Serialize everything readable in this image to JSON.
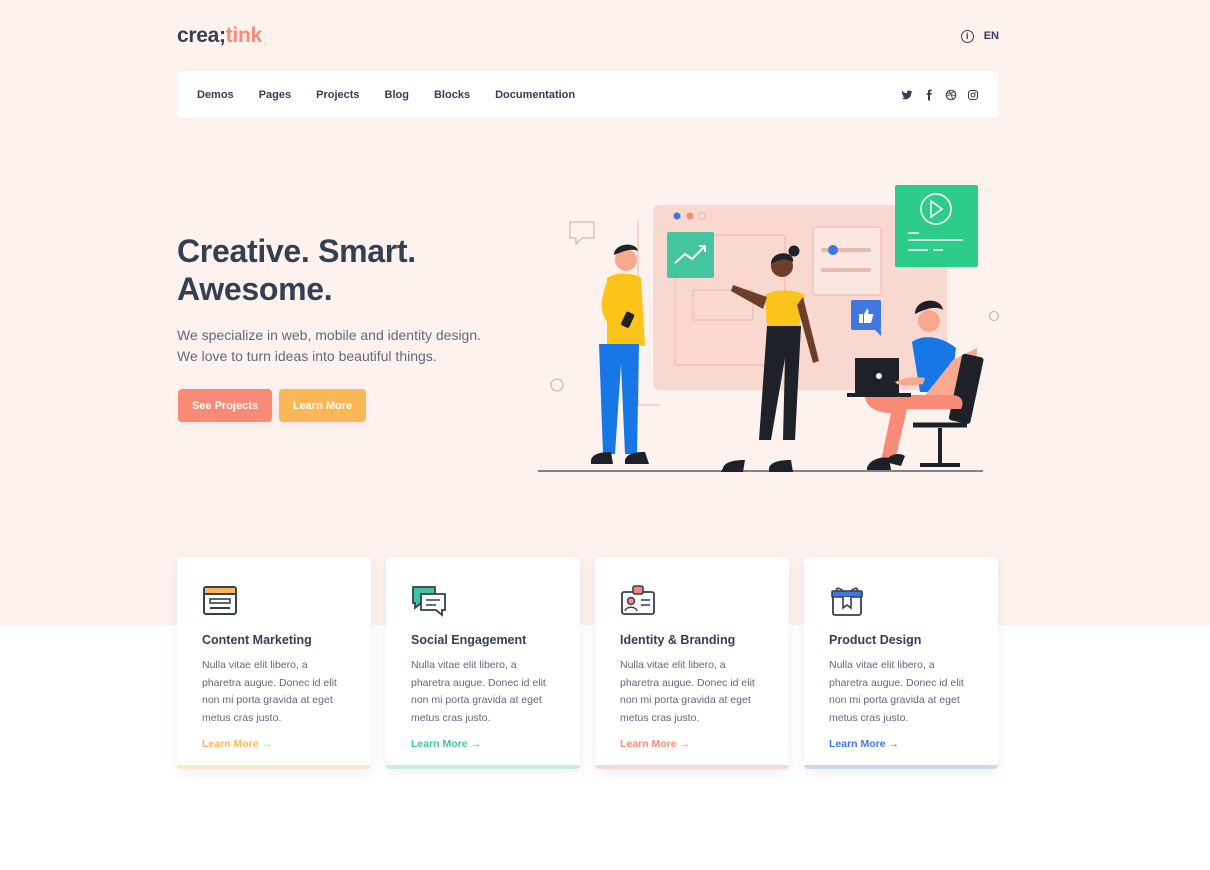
{
  "brand": {
    "logo_main": "crea;",
    "logo_accent": "tink",
    "accent_color": "#f78b77"
  },
  "topbar": {
    "language": "EN",
    "info_icon": "info-icon"
  },
  "nav": {
    "links": [
      "Demos",
      "Pages",
      "Projects",
      "Blog",
      "Blocks",
      "Documentation"
    ],
    "social": [
      "twitter-icon",
      "facebook-icon",
      "dribbble-icon",
      "instagram-icon"
    ]
  },
  "hero": {
    "title": "Creative. Smart. Awesome.",
    "subtitle_line1": "We specialize in web, mobile and identity design.",
    "subtitle_line2": "We love to turn ideas into beautiful things.",
    "primary_button": "See Projects",
    "secondary_button": "Learn More",
    "background": "#fef2ef"
  },
  "cards": [
    {
      "title": "Content Marketing",
      "text": "Nulla vitae elit libero, a pharetra augue. Donec id elit non mi porta gravida at eget metus cras justo.",
      "link": "Learn More →",
      "color": "#fab758",
      "icon": "browser-window-icon"
    },
    {
      "title": "Social Engagement",
      "text": "Nulla vitae elit libero, a pharetra augue. Donec id elit non mi porta gravida at eget metus cras justo.",
      "link": "Learn More →",
      "color": "#45c4a0",
      "icon": "chat-bubbles-icon"
    },
    {
      "title": "Identity & Branding",
      "text": "Nulla vitae elit libero, a pharetra augue. Donec id elit non mi porta gravida at eget metus cras justo.",
      "link": "Learn More →",
      "color": "#f78b77",
      "icon": "id-card-icon"
    },
    {
      "title": "Product Design",
      "text": "Nulla vitae elit libero, a pharetra augue. Donec id elit non mi porta gravida at eget metus cras justo.",
      "link": "Learn More →",
      "color": "#3f78e0",
      "icon": "gift-box-icon"
    }
  ]
}
